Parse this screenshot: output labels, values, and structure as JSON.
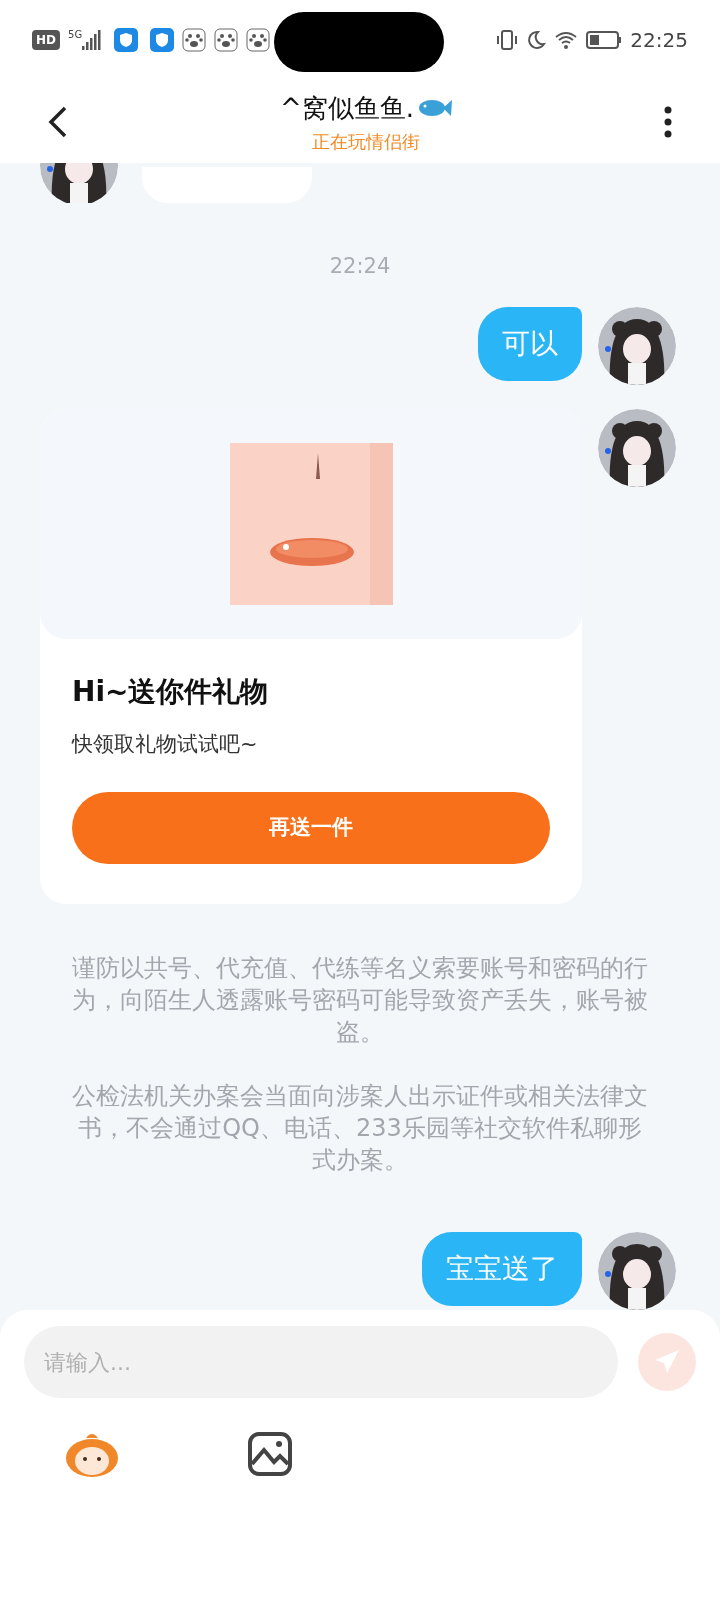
{
  "status_bar": {
    "hd": "HD",
    "network": "5G",
    "time": "22:25"
  },
  "header": {
    "title": "^窝似鱼鱼.",
    "subtitle": "正在玩情侣街"
  },
  "messages": [
    {
      "kind": "partial"
    },
    {
      "kind": "timestamp",
      "text": "22:24"
    },
    {
      "kind": "outgoing",
      "text": "可以"
    },
    {
      "kind": "gift_card",
      "title": "Hi~送你件礼物",
      "subtitle": "快领取礼物试试吧~",
      "button": "再送一件"
    },
    {
      "kind": "notice",
      "paragraphs": [
        "谨防以共号、代充值、代练等名义索要账号和密码的行为，向陌生人透露账号密码可能导致资产丢失，账号被盗。",
        "公检法机关办案会当面向涉案人出示证件或相关法律文书，不会通过QQ、电话、233乐园等社交软件私聊形式办案。"
      ]
    },
    {
      "kind": "outgoing",
      "text": "宝宝送了"
    }
  ],
  "composer": {
    "placeholder": "请输入...",
    "send_disabled": true
  }
}
